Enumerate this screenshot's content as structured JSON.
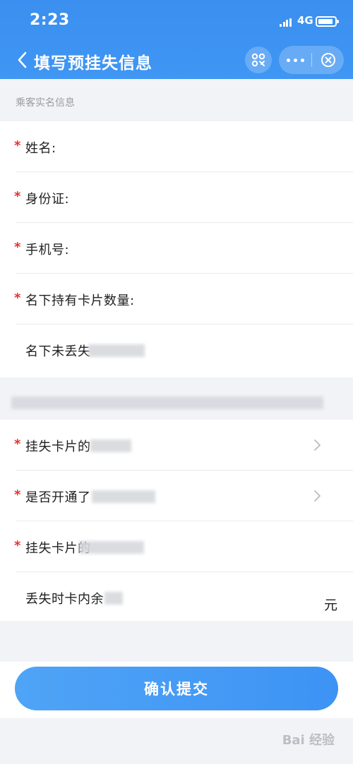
{
  "status_bar": {
    "time": "2:23",
    "network": "4G",
    "battery_level": 0.9
  },
  "nav": {
    "title": "填写预挂失信息",
    "icons": [
      "back-icon",
      "scan-icon",
      "more-icon",
      "close-icon"
    ]
  },
  "section": {
    "title": "乘客实名信息"
  },
  "form_group_1": [
    {
      "label": "姓名:",
      "required": true
    },
    {
      "label": "身份证:",
      "required": true
    },
    {
      "label": "手机号:",
      "required": true
    },
    {
      "label": "名下持有卡片数量:",
      "required": true
    },
    {
      "label": "名下未丢失",
      "required": false
    }
  ],
  "form_group_2": [
    {
      "label": "挂失卡片的",
      "required": true,
      "chevron": true
    },
    {
      "label": "是否开通了",
      "required": true,
      "chevron": true
    },
    {
      "label": "挂失卡片的",
      "required": true,
      "chevron": false
    },
    {
      "label": "丢失时卡内余",
      "required": false,
      "unit": "元"
    }
  ],
  "required_mark": "*",
  "submit": {
    "label": "确认提交"
  },
  "watermark": "Bai 经验",
  "colors": {
    "accent": "#3b8ff0",
    "required": "#e3312f",
    "button": "#4a9ff6"
  }
}
